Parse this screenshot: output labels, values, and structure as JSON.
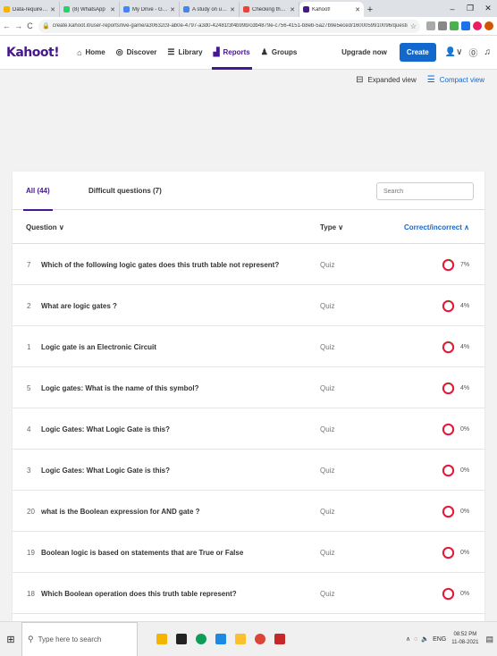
{
  "browser": {
    "tabs": [
      {
        "label": "Data-requirement-We",
        "color": "#f4b400"
      },
      {
        "label": "(8) WhatsApp",
        "color": "#25d366"
      },
      {
        "label": "My Drive - Google Dri",
        "color": "#4285f4"
      },
      {
        "label": "A study on useful techn",
        "color": "#4285f4"
      },
      {
        "label": "Checking the files sharing",
        "color": "#ea4335"
      },
      {
        "label": "Kahoot!",
        "color": "#46178f"
      }
    ],
    "url": "create.kahoot.it/user-reports/live-game/a30632c9-ab0e-4797-a3d0-42481f3f4b99b/cdb4879e-c756-4151-b8eb-5a27b9e5eced/1600059910096/questio..."
  },
  "header": {
    "logo": "Kahoot!",
    "nav": [
      {
        "label": "Home",
        "icon": "⌂"
      },
      {
        "label": "Discover",
        "icon": "◎"
      },
      {
        "label": "Library",
        "icon": "☰"
      },
      {
        "label": "Reports",
        "icon": "▟"
      },
      {
        "label": "Groups",
        "icon": "♟"
      }
    ],
    "upgrade": "Upgrade now",
    "create": "Create",
    "accent": "#46178f",
    "create_color": "#1368ce"
  },
  "view_toggle": {
    "expanded": "Expanded view",
    "compact": "Compact view"
  },
  "filters": {
    "all": "All (44)",
    "difficult": "Difficult questions (7)",
    "search_placeholder": "Search"
  },
  "table": {
    "columns": {
      "question": "Question ∨",
      "type": "Type ∨",
      "correct": "Correct/incorrect ∧"
    },
    "rows": [
      {
        "num": "7",
        "question": "Which of the following logic gates does this truth table not represent?",
        "type": "Quiz",
        "pct": "7%",
        "correct": 0.07
      },
      {
        "num": "2",
        "question": "What are logic gates ?",
        "type": "Quiz",
        "pct": "4%",
        "correct": 0.04
      },
      {
        "num": "1",
        "question": "Logic gate is an Electronic Circuit",
        "type": "Quiz",
        "pct": "4%",
        "correct": 0.04
      },
      {
        "num": "5",
        "question": "Logic gates: What is the name of this symbol?",
        "type": "Quiz",
        "pct": "4%",
        "correct": 0.04
      },
      {
        "num": "4",
        "question": "Logic Gates: What Logic Gate is this?",
        "type": "Quiz",
        "pct": "0%",
        "correct": 0
      },
      {
        "num": "3",
        "question": "Logic Gates: What Logic Gate is this?",
        "type": "Quiz",
        "pct": "0%",
        "correct": 0
      },
      {
        "num": "20",
        "question": "what is the Boolean expression for AND gate ?",
        "type": "Quiz",
        "pct": "0%",
        "correct": 0
      },
      {
        "num": "19",
        "question": "Boolean logic is based on statements that are True or False",
        "type": "Quiz",
        "pct": "0%",
        "correct": 0
      },
      {
        "num": "18",
        "question": "Which Boolean operation does this truth table represent?",
        "type": "Quiz",
        "pct": "0%",
        "correct": 0
      }
    ],
    "correct_color": "#26890c",
    "incorrect_color": "#e21b3c"
  },
  "taskbar": {
    "search_placeholder": "Type here to search",
    "lang": "ENG",
    "time": "08:52 PM",
    "date": "11-08-2021"
  }
}
